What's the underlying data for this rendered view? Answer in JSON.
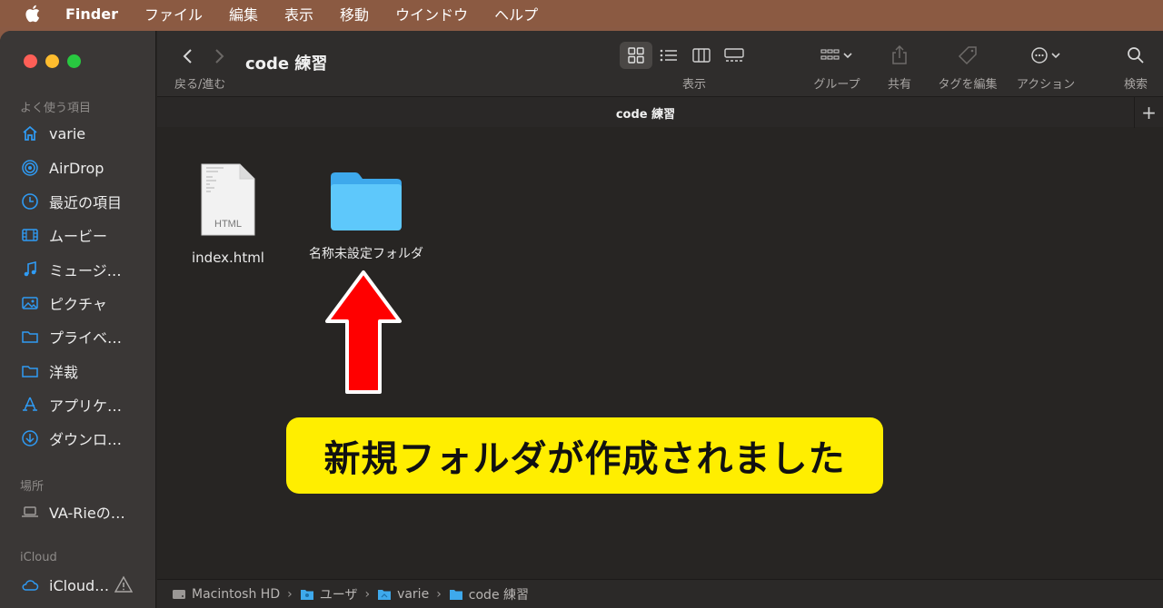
{
  "menubar": {
    "app": "Finder",
    "items": [
      "ファイル",
      "編集",
      "表示",
      "移動",
      "ウインドウ",
      "ヘルプ"
    ]
  },
  "sidebar": {
    "favorites_title": "よく使う項目",
    "favorites": [
      {
        "label": "varie",
        "icon": "home-icon"
      },
      {
        "label": "AirDrop",
        "icon": "airdrop-icon"
      },
      {
        "label": "最近の項目",
        "icon": "clock-icon"
      },
      {
        "label": "ムービー",
        "icon": "film-icon"
      },
      {
        "label": "ミュージ…",
        "icon": "music-icon"
      },
      {
        "label": "ピクチャ",
        "icon": "photo-icon"
      },
      {
        "label": "プライベ…",
        "icon": "folder-icon"
      },
      {
        "label": "洋裁",
        "icon": "folder-icon"
      },
      {
        "label": "アプリケ…",
        "icon": "apps-icon"
      },
      {
        "label": "ダウンロ…",
        "icon": "download-icon"
      }
    ],
    "locations_title": "場所",
    "locations": [
      {
        "label": "VA-Rieの…",
        "icon": "laptop-icon"
      }
    ],
    "icloud_title": "iCloud",
    "icloud": [
      {
        "label": "iCloud…",
        "icon": "cloud-icon"
      }
    ]
  },
  "toolbar": {
    "nav_label": "戻る/進む",
    "title": "code 練習",
    "view_label": "表示",
    "group_label": "グループ",
    "share_label": "共有",
    "tag_label": "タグを編集",
    "action_label": "アクション",
    "search_label": "検索"
  },
  "tab": {
    "title": "code 練習",
    "plus": "+"
  },
  "files": [
    {
      "name": "index.html",
      "badge": "HTML",
      "kind": "html-file-icon"
    },
    {
      "name": "名称未設定フォルダ",
      "kind": "folder-icon"
    }
  ],
  "pathbar": [
    "Macintosh HD",
    "ユーザ",
    "varie",
    "code 練習"
  ],
  "annotation": {
    "callout": "新規フォルダが作成されました",
    "colors": {
      "callout_bg": "#ffee00",
      "arrow": "#ff0000"
    }
  }
}
